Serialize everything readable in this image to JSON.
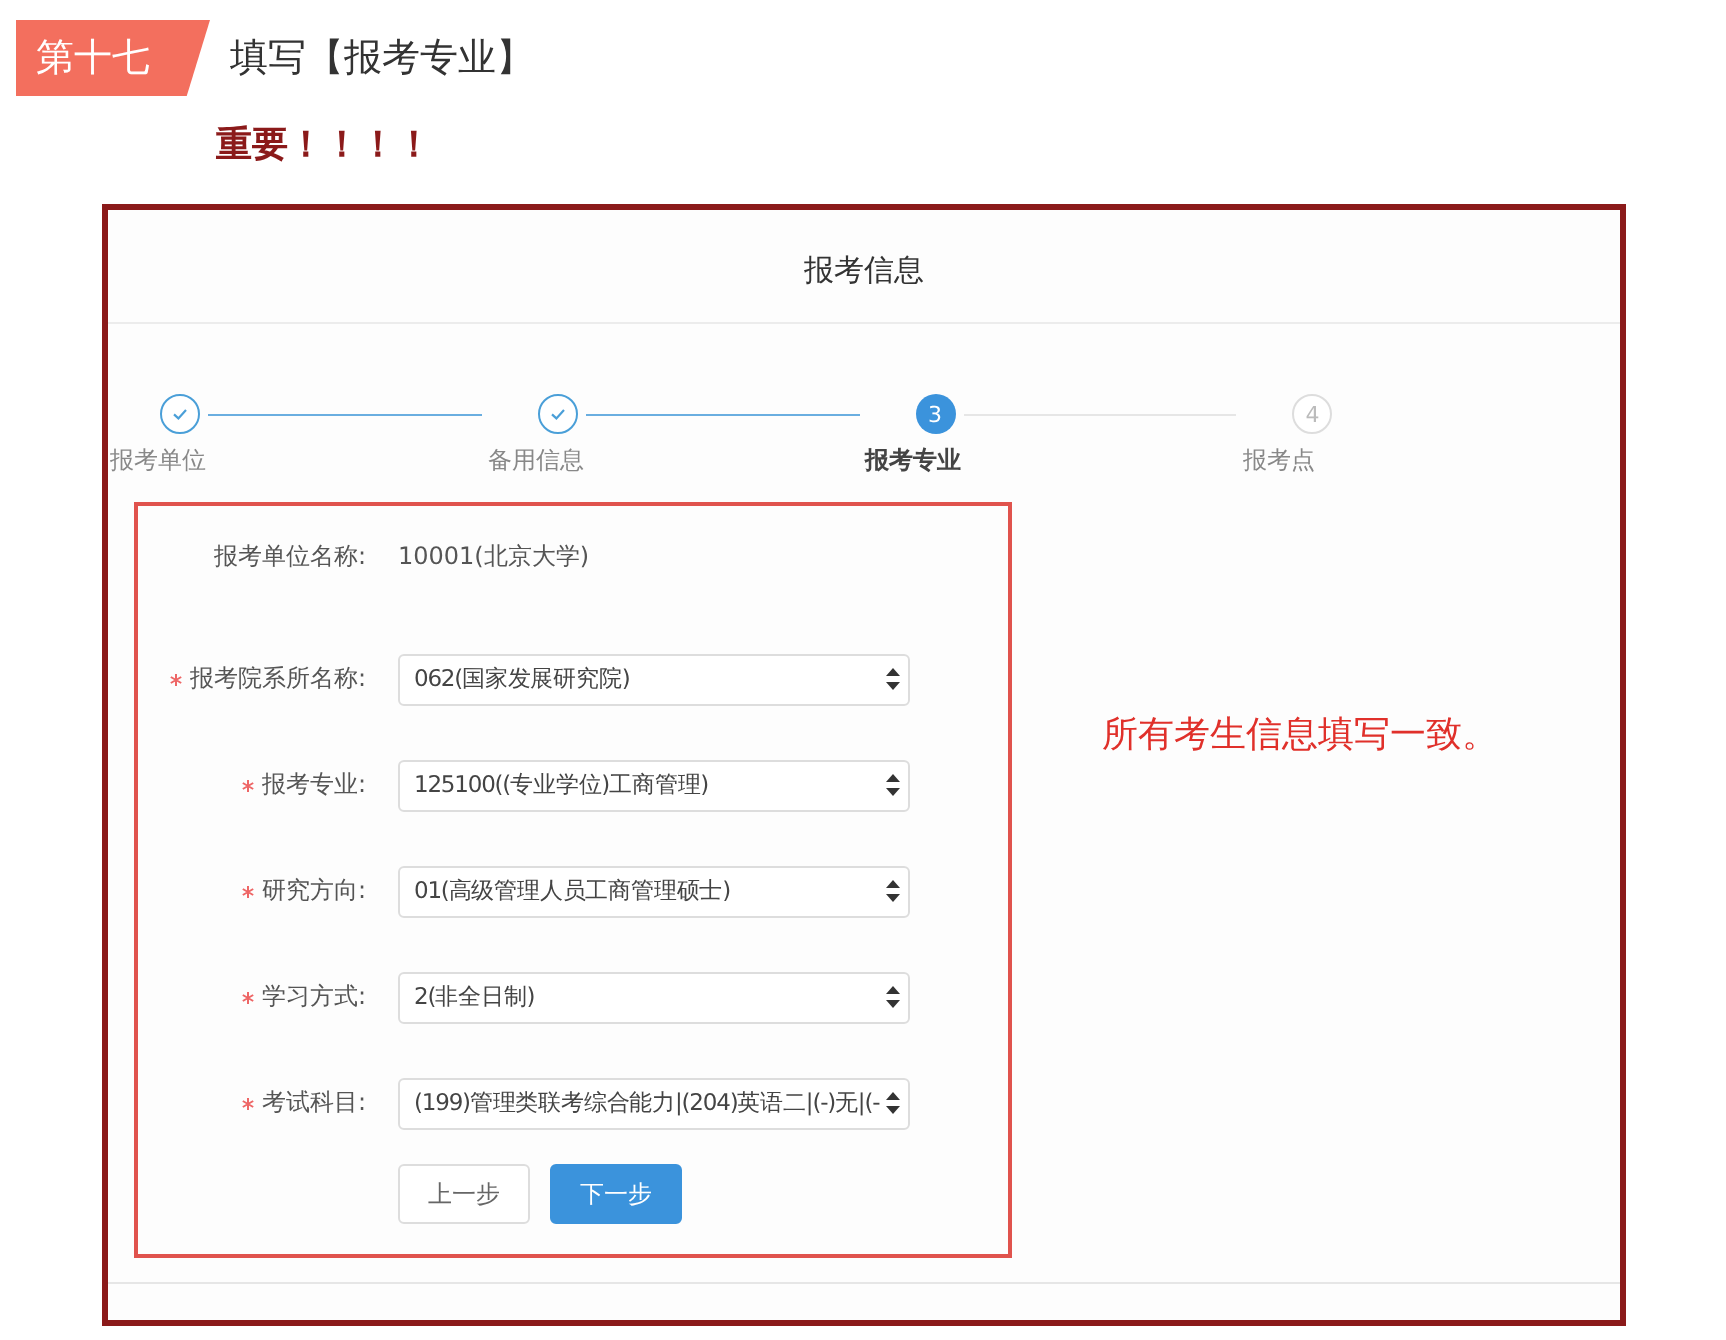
{
  "heading": {
    "badge": "第十七",
    "title": "填写【报考专业】",
    "note": "重要！！！！"
  },
  "panel": {
    "title": "报考信息",
    "steps": [
      {
        "label": "报考单位",
        "kind": "done"
      },
      {
        "label": "备用信息",
        "kind": "done"
      },
      {
        "number": "3",
        "label": "报考专业",
        "kind": "active"
      },
      {
        "number": "4",
        "label": "报考点",
        "kind": "todo"
      }
    ],
    "fields": [
      {
        "kind": "text",
        "label": "报考单位名称:",
        "value": "10001(北京大学)",
        "required": false
      },
      {
        "kind": "select",
        "label": "报考院系所名称:",
        "value": "062(国家发展研究院)",
        "required": true
      },
      {
        "kind": "select",
        "label": "报考专业:",
        "value": "125100((专业学位)工商管理)",
        "required": true
      },
      {
        "kind": "select",
        "label": "研究方向:",
        "value": "01(高级管理人员工商管理硕士)",
        "required": true
      },
      {
        "kind": "select",
        "label": "学习方式:",
        "value": "2(非全日制)",
        "required": true
      },
      {
        "kind": "select",
        "label": "考试科目:",
        "value": "(199)管理类联考综合能力|(204)英语二|(-)无|(-",
        "required": true
      }
    ],
    "buttons": [
      {
        "label": "上一步",
        "primary": false
      },
      {
        "label": "下一步",
        "primary": true
      }
    ],
    "annotation": "所有考生信息填写一致。"
  }
}
